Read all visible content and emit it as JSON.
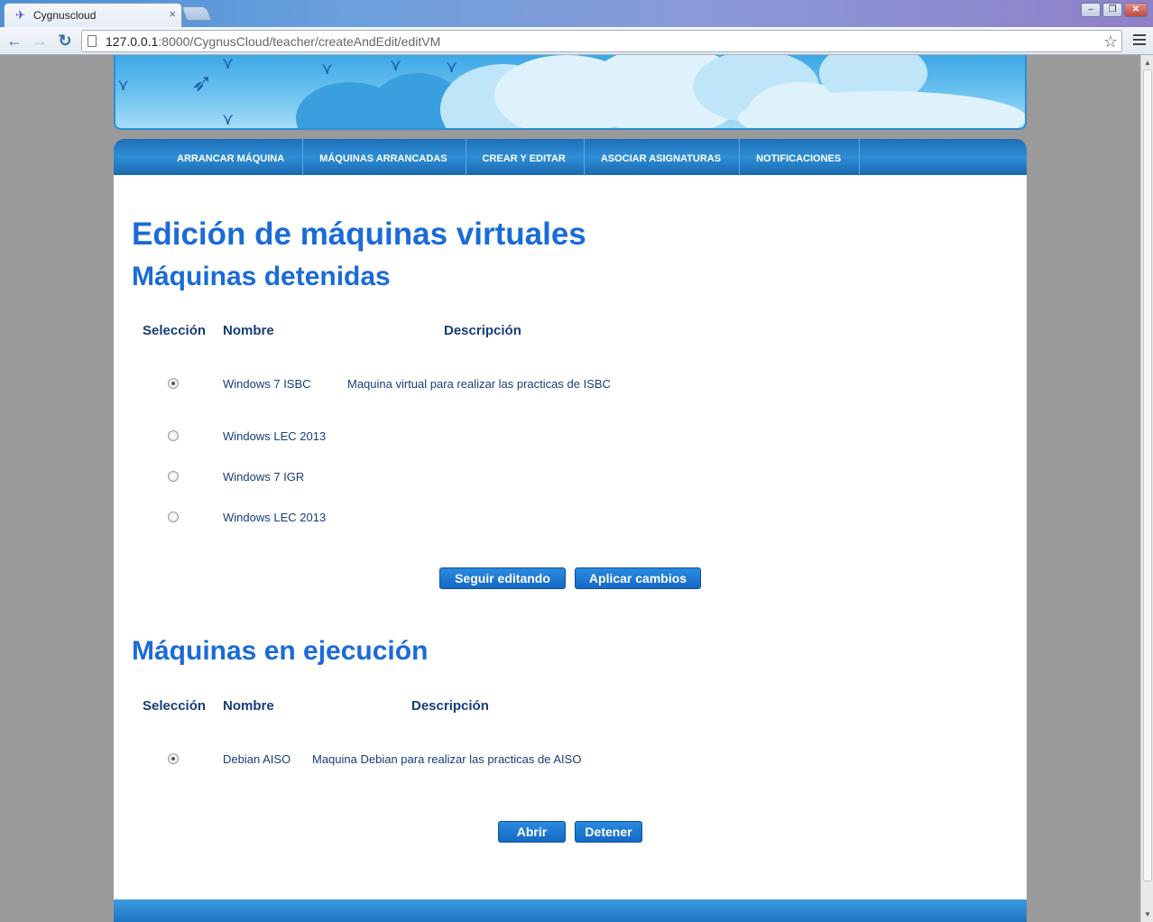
{
  "browser": {
    "tab_title": "Cygnuscloud",
    "tab_close": "×",
    "url_host": "127.0.0.1",
    "url_rest": ":8000/CygnusCloud/teacher/createAndEdit/editVM",
    "back_glyph": "←",
    "forward_glyph": "→",
    "reload_glyph": "↻",
    "star_glyph": "☆",
    "minimize_glyph": "–",
    "restore_glyph": "❐",
    "close_glyph": "✕",
    "icons": [
      "back-icon",
      "forward-icon",
      "reload-icon",
      "page-icon",
      "bookmark-star-icon",
      "menu-icon"
    ]
  },
  "nav": {
    "items": [
      "ARRANCAR MÁQUINA",
      "MÁQUINAS ARRANCADAS",
      "CREAR Y EDITAR",
      "ASOCIAR ASIGNATURAS",
      "NOTIFICACIONES"
    ]
  },
  "page": {
    "title": "Edición de máquinas virtuales"
  },
  "stopped": {
    "heading": "Máquinas detenidas",
    "columns": [
      "Selección",
      "Nombre",
      "Descripción"
    ],
    "rows": [
      {
        "name": "Windows 7 ISBC",
        "description": "Maquina virtual para realizar las practicas de ISBC",
        "selected": true
      },
      {
        "name": "Windows LEC 2013",
        "description": "",
        "selected": false
      },
      {
        "name": "Windows 7 IGR",
        "description": "",
        "selected": false
      },
      {
        "name": "Windows LEC 2013",
        "description": "",
        "selected": false
      }
    ],
    "buttons": {
      "continue": "Seguir editando",
      "apply": "Aplicar cambios"
    }
  },
  "running": {
    "heading": "Máquinas en ejecución",
    "columns": [
      "Selección",
      "Nombre",
      "Descripción"
    ],
    "rows": [
      {
        "name": "Debian AISO",
        "description": "Maquina Debian para realizar las practicas de AISO",
        "selected": true
      }
    ],
    "buttons": {
      "open": "Abrir",
      "stop": "Detener"
    }
  },
  "colors": {
    "heading": "#1a6bd8",
    "table_text": "#173d7a",
    "nav_bg": "#1e6fb6",
    "button_bg": "#1a78d2"
  }
}
